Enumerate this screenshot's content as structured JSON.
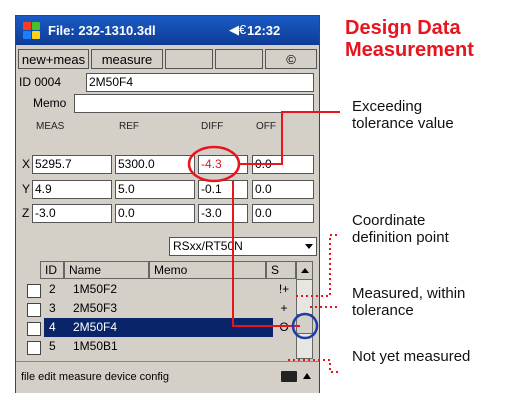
{
  "annotation": {
    "title_line1": "Design Data",
    "title_line2": "Measurement",
    "exceeding_line1": "Exceeding",
    "exceeding_line2": "tolerance value",
    "coord_line1": "Coordinate",
    "coord_line2": "definition point",
    "measured_line1": "Measured, within",
    "measured_line2": "tolerance",
    "not_measured": "Not yet measured"
  },
  "titlebar": {
    "title": "File: 232-1310.3dl",
    "speaker": "◀€",
    "time": "12:32"
  },
  "toolbar": {
    "new_meas": "new+meas",
    "measure": "measure",
    "copyright": "©"
  },
  "id_row": {
    "label": "ID 0004",
    "value": "2M50F4"
  },
  "memo_row": {
    "label": "Memo",
    "value": ""
  },
  "grid": {
    "headers": [
      "MEAS",
      "REF",
      "DIFF",
      "OFF"
    ],
    "rows": [
      {
        "axis": "X",
        "meas": "5295.7",
        "ref": "5300.0",
        "diff": "-4.3",
        "off": "0.0"
      },
      {
        "axis": "Y",
        "meas": "4.9",
        "ref": "5.0",
        "diff": "-0.1",
        "off": "0.0"
      },
      {
        "axis": "Z",
        "meas": "-3.0",
        "ref": "0.0",
        "diff": "-3.0",
        "off": "0.0"
      }
    ]
  },
  "dropdown": {
    "value": "RSxx/RT50N"
  },
  "list": {
    "headers": {
      "id": "ID",
      "name": "Name",
      "memo": "Memo",
      "s": "S"
    },
    "rows": [
      {
        "id": "2",
        "name": "1M50F2",
        "status": "!+"
      },
      {
        "id": "3",
        "name": "2M50F3",
        "status": "+"
      },
      {
        "id": "4",
        "name": "2M50F4",
        "status": "O"
      },
      {
        "id": "5",
        "name": "1M50B1",
        "status": ""
      }
    ]
  },
  "menu": {
    "text": "file  edit  measure  device  config"
  },
  "colors": {
    "accent": "#e8141e",
    "titlebar": "#1a5bc4",
    "selection": "#0a246a"
  }
}
